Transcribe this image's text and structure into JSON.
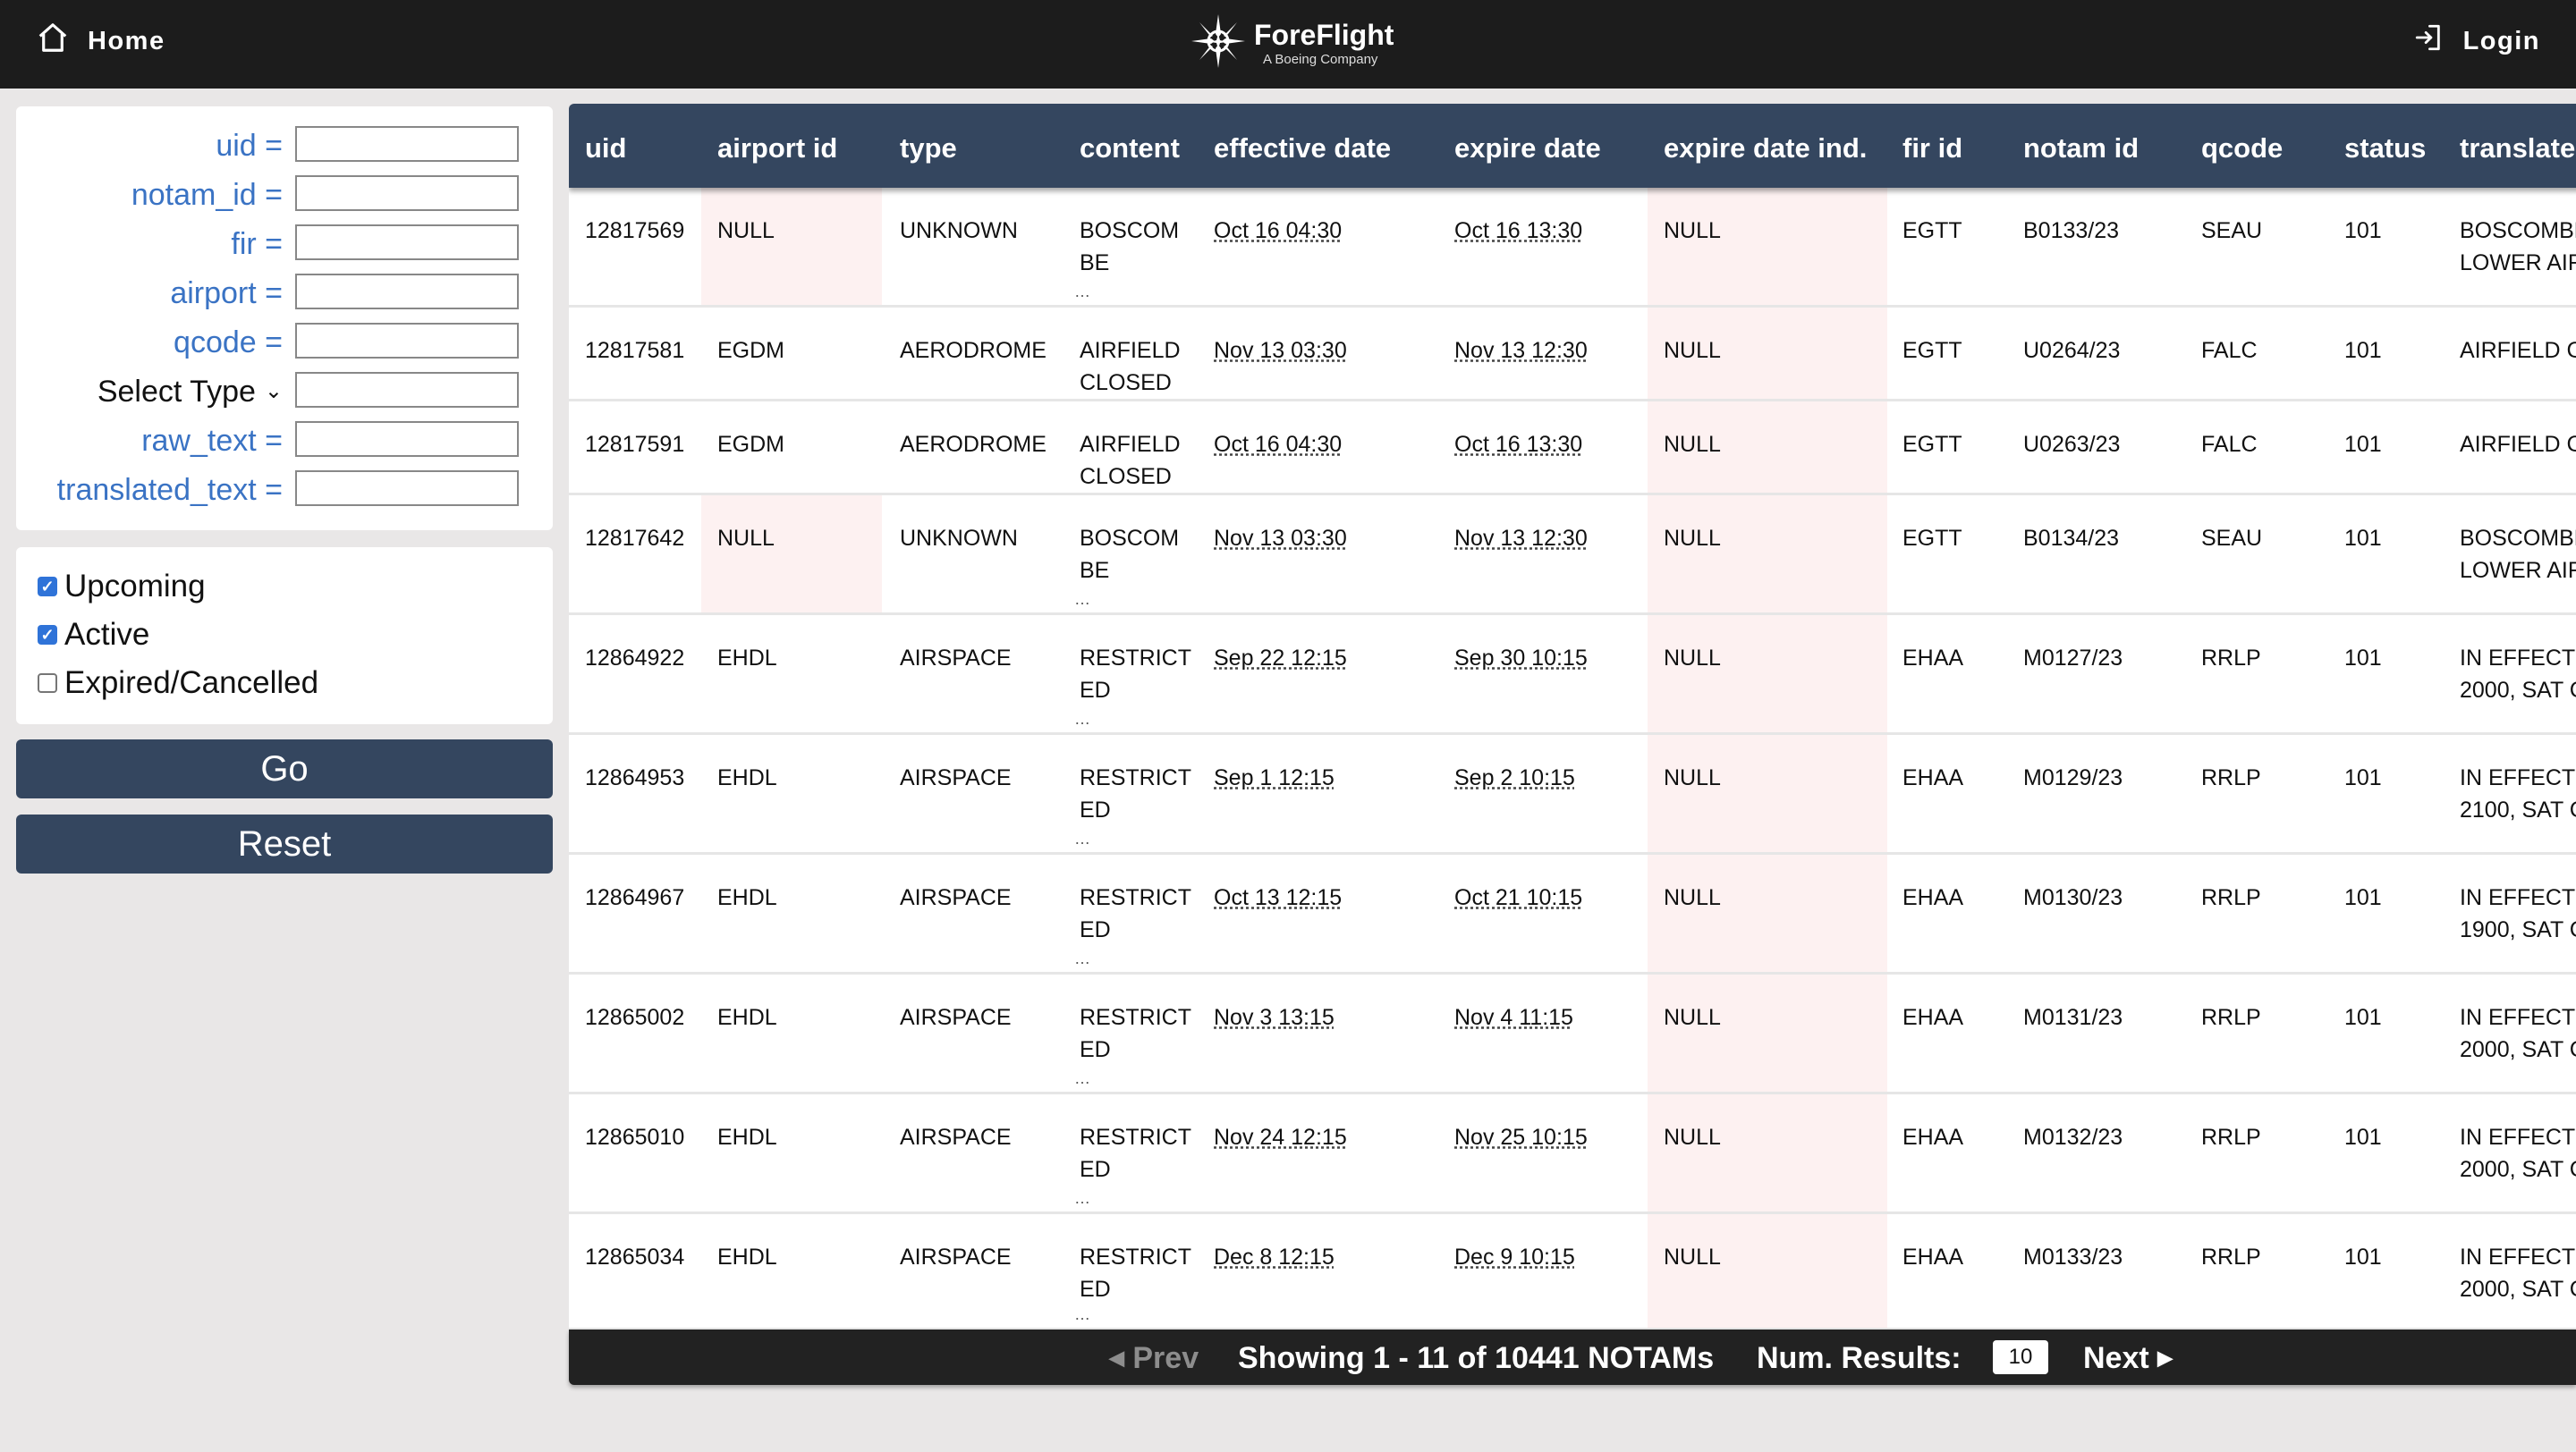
{
  "nav": {
    "home_label": "Home",
    "login_label": "Login",
    "logo_name": "ForeFlight",
    "logo_sub": "A Boeing Company",
    "home_icon": "home-icon",
    "login_icon": "login-icon"
  },
  "filters": {
    "fields": [
      {
        "label": "uid =",
        "value": ""
      },
      {
        "label": "notam_id =",
        "value": ""
      },
      {
        "label": "fir =",
        "value": ""
      },
      {
        "label": "airport =",
        "value": ""
      },
      {
        "label": "qcode =",
        "value": ""
      },
      {
        "label": "Select Type",
        "value": ""
      },
      {
        "label": "raw_text =",
        "value": ""
      },
      {
        "label": "translated_text =",
        "value": ""
      }
    ],
    "checks": [
      {
        "label": "Upcoming",
        "checked": true
      },
      {
        "label": "Active",
        "checked": true
      },
      {
        "label": "Expired/Cancelled",
        "checked": false
      }
    ],
    "go_label": "Go",
    "reset_label": "Reset"
  },
  "table": {
    "columns": [
      "uid",
      "airport id",
      "type",
      "content",
      "effective date",
      "expire date",
      "expire date ind.",
      "fir id",
      "notam id",
      "qcode",
      "status",
      "translated"
    ],
    "rows": [
      {
        "uid": "12817569",
        "airport": "NULL",
        "type": "UNKNOWN",
        "content": "BOSCOMBE",
        "effective": "Oct 16 04:30",
        "expire": "Oct 16 13:30",
        "expire_ind": "NULL",
        "fir": "EGTT",
        "notam": "B0133/23",
        "qcode": "SEAU",
        "status": "101",
        "trans1": "BOSCOMBE",
        "trans2": "LOWER AIR"
      },
      {
        "uid": "12817581",
        "airport": "EGDM",
        "type": "AERODROME",
        "content": "AIRFIELD CLOSED",
        "effective": "Nov 13 03:30",
        "expire": "Nov 13 12:30",
        "expire_ind": "NULL",
        "fir": "EGTT",
        "notam": "U0264/23",
        "qcode": "FALC",
        "status": "101",
        "trans1": "AIRFIELD C",
        "trans2": ""
      },
      {
        "uid": "12817591",
        "airport": "EGDM",
        "type": "AERODROME",
        "content": "AIRFIELD CLOSED",
        "effective": "Oct 16 04:30",
        "expire": "Oct 16 13:30",
        "expire_ind": "NULL",
        "fir": "EGTT",
        "notam": "U0263/23",
        "qcode": "FALC",
        "status": "101",
        "trans1": "AIRFIELD C",
        "trans2": ""
      },
      {
        "uid": "12817642",
        "airport": "NULL",
        "type": "UNKNOWN",
        "content": "BOSCOMBE",
        "effective": "Nov 13 03:30",
        "expire": "Nov 13 12:30",
        "expire_ind": "NULL",
        "fir": "EGTT",
        "notam": "B0134/23",
        "qcode": "SEAU",
        "status": "101",
        "trans1": "BOSCOMBE",
        "trans2": "LOWER AIR"
      },
      {
        "uid": "12864922",
        "airport": "EHDL",
        "type": "AIRSPACE",
        "content": "RESTRICTED",
        "effective": "Sep 22 12:15",
        "expire": "Sep 30 10:15",
        "expire_ind": "NULL",
        "fir": "EHAA",
        "notam": "M0127/23",
        "qcode": "RRLP",
        "status": "101",
        "trans1": "IN EFFECT",
        "trans2": "2000, SAT C"
      },
      {
        "uid": "12864953",
        "airport": "EHDL",
        "type": "AIRSPACE",
        "content": "RESTRICTED",
        "effective": "Sep 1 12:15",
        "expire": "Sep 2 10:15",
        "expire_ind": "NULL",
        "fir": "EHAA",
        "notam": "M0129/23",
        "qcode": "RRLP",
        "status": "101",
        "trans1": "IN EFFECT",
        "trans2": "2100, SAT C"
      },
      {
        "uid": "12864967",
        "airport": "EHDL",
        "type": "AIRSPACE",
        "content": "RESTRICTED",
        "effective": "Oct 13 12:15",
        "expire": "Oct 21 10:15",
        "expire_ind": "NULL",
        "fir": "EHAA",
        "notam": "M0130/23",
        "qcode": "RRLP",
        "status": "101",
        "trans1": "IN EFFECT",
        "trans2": "1900, SAT C"
      },
      {
        "uid": "12865002",
        "airport": "EHDL",
        "type": "AIRSPACE",
        "content": "RESTRICTED",
        "effective": "Nov 3 13:15",
        "expire": "Nov 4 11:15",
        "expire_ind": "NULL",
        "fir": "EHAA",
        "notam": "M0131/23",
        "qcode": "RRLP",
        "status": "101",
        "trans1": "IN EFFECT",
        "trans2": "2000, SAT C"
      },
      {
        "uid": "12865010",
        "airport": "EHDL",
        "type": "AIRSPACE",
        "content": "RESTRICTED",
        "effective": "Nov 24 12:15",
        "expire": "Nov 25 10:15",
        "expire_ind": "NULL",
        "fir": "EHAA",
        "notam": "M0132/23",
        "qcode": "RRLP",
        "status": "101",
        "trans1": "IN EFFECT",
        "trans2": "2000, SAT C"
      },
      {
        "uid": "12865034",
        "airport": "EHDL",
        "type": "AIRSPACE",
        "content": "RESTRICTED",
        "effective": "Dec 8 12:15",
        "expire": "Dec 9 10:15",
        "expire_ind": "NULL",
        "fir": "EHAA",
        "notam": "M0133/23",
        "qcode": "RRLP",
        "status": "101",
        "trans1": "IN EFFECT",
        "trans2": "2000, SAT C"
      }
    ]
  },
  "pager": {
    "prev_label": "Prev",
    "info": "Showing 1 - 11 of 10441 NOTAMs",
    "num_label": "Num. Results:",
    "num_value": "10",
    "next_label": "Next"
  },
  "colors": {
    "nav_bg": "#1c1c1c",
    "header_bg": "#34465f",
    "label_blue": "#3a73c4",
    "null_highlight": "#fdf1f1",
    "checkbox_blue": "#2f73d8"
  }
}
